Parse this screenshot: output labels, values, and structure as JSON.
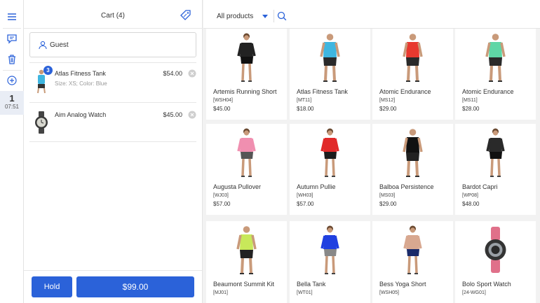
{
  "rail": {
    "session_number": "1",
    "session_time": "07:51"
  },
  "cart": {
    "title": "Cart (4)",
    "customer": "Guest",
    "items": [
      {
        "name": "Atlas Fitness Tank",
        "options": "Size: XS; Color: Blue",
        "price": "$54.00",
        "qty": "3"
      },
      {
        "name": "Aim Analog Watch",
        "options": "",
        "price": "$45.00",
        "qty": ""
      }
    ],
    "hold_label": "Hold",
    "pay_label": "$99.00"
  },
  "catalog": {
    "category": "All products",
    "accent": "#2b62d9",
    "products": [
      {
        "name": "Artemis Running Short",
        "sku": "[WSH04]",
        "price": "$45.00",
        "figure": "woman",
        "top": "#222222",
        "bottom": "#111111"
      },
      {
        "name": "Atlas Fitness Tank",
        "sku": "[MT11]",
        "price": "$18.00",
        "figure": "man",
        "top": "#3fb6e0",
        "bottom": "#2a2a2a"
      },
      {
        "name": "Atomic Endurance",
        "sku": "[MS12]",
        "price": "$29.00",
        "figure": "man",
        "top": "#e8392f",
        "bottom": "#2a2a2a"
      },
      {
        "name": "Atomic Endurance",
        "sku": "[MS11]",
        "price": "$28.00",
        "figure": "man",
        "top": "#5fd6a6",
        "bottom": "#2a2a2a"
      },
      {
        "name": "Augusta Pullover",
        "sku": "[WJ03]",
        "price": "$57.00",
        "figure": "woman",
        "top": "#f08fb0",
        "bottom": "#555555"
      },
      {
        "name": "Autumn Pullie",
        "sku": "[WH03]",
        "price": "$57.00",
        "figure": "woman",
        "top": "#e12a2a",
        "bottom": "#1c1c1c"
      },
      {
        "name": "Balboa Persistence",
        "sku": "[MS03]",
        "price": "$29.00",
        "figure": "man",
        "top": "#111111",
        "bottom": "#222222"
      },
      {
        "name": "Bardot Capri",
        "sku": "[WP08]",
        "price": "$48.00",
        "figure": "woman",
        "top": "#2a2a2a",
        "bottom": "#111111"
      },
      {
        "name": "Beaumont Summit Kit",
        "sku": "[MJ01]",
        "price": "",
        "figure": "man",
        "top": "#c8e85a",
        "bottom": "#222222"
      },
      {
        "name": "Bella Tank",
        "sku": "[WT01]",
        "price": "",
        "figure": "woman",
        "top": "#2040e0",
        "bottom": "#888888"
      },
      {
        "name": "Bess Yoga Short",
        "sku": "[WSH05]",
        "price": "",
        "figure": "woman",
        "top": "#d8a890",
        "bottom": "#1a2a6a"
      },
      {
        "name": "Bolo Sport Watch",
        "sku": "[24-WG01]",
        "price": "",
        "figure": "watch",
        "top": "#555555",
        "bottom": "#e0708a"
      }
    ]
  }
}
